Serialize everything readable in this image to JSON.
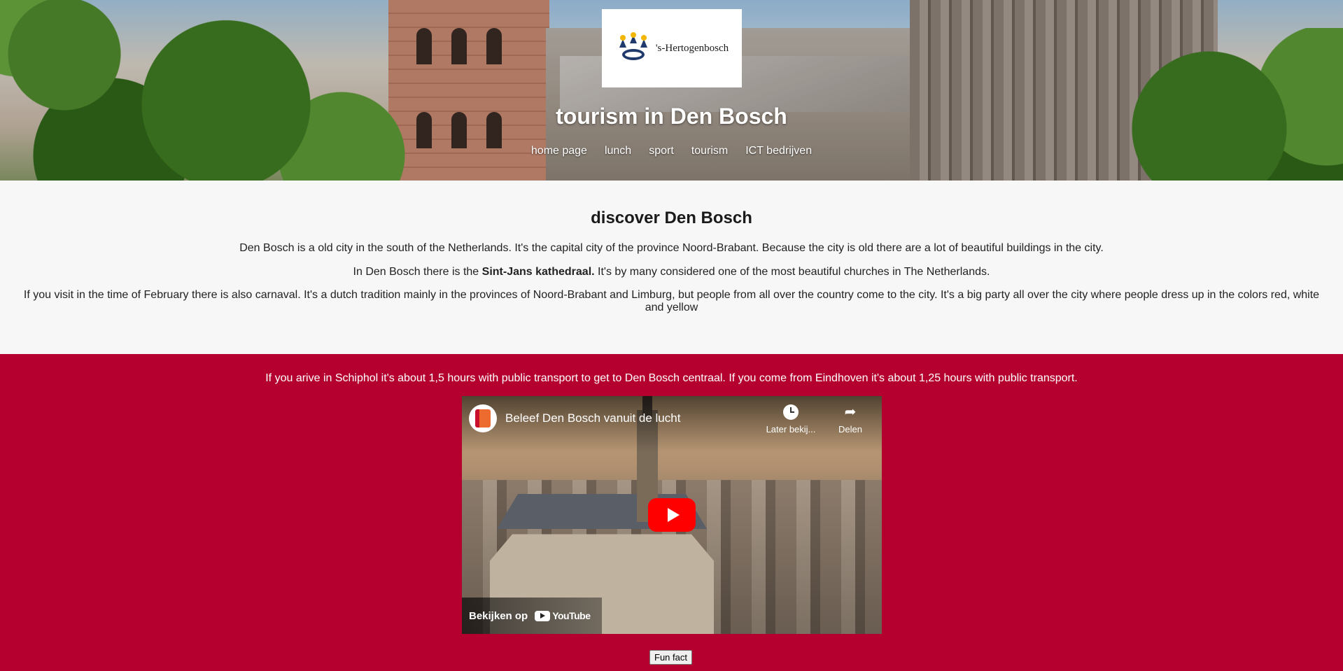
{
  "header": {
    "logo_text": "'s-Hertogenbosch",
    "title": "tourism in Den Bosch",
    "nav": [
      "home page",
      "lunch",
      "sport",
      "tourism",
      "ICT bedrijven"
    ]
  },
  "intro": {
    "heading": "discover Den Bosch",
    "p1": "Den Bosch is a old city in the south of the Netherlands. It's the capital city of the province Noord-Brabant. Because the city is old there are a lot of beautiful buildings in the city.",
    "p2_before": "In Den Bosch there is the ",
    "p2_bold": "Sint-Jans kathedraal.",
    "p2_after": " It's by many considered one of the most beautiful churches in The Netherlands.",
    "p3": "If you visit in the time of February there is also carnaval. It's a dutch tradition mainly in the provinces of Noord-Brabant and Limburg, but people from all over the country come to the city. It's a big party all over the city where people dress up in the colors red, white and yellow"
  },
  "transport": {
    "text": "If you arive in Schiphol it's about 1,5 hours with public transport to get to Den Bosch centraal. If you come from Eindhoven it's about 1,25 hours with public transport."
  },
  "video": {
    "title": "Beleef Den Bosch vanuit de lucht",
    "watch_later": "Later bekij...",
    "share": "Delen",
    "watch_on": "Bekijken op",
    "platform": "YouTube"
  },
  "funfact_button": "Fun fact",
  "colors": {
    "red_section": "#b5002f",
    "intro_bg": "#f7f7f7",
    "play_button": "#ff0000"
  }
}
